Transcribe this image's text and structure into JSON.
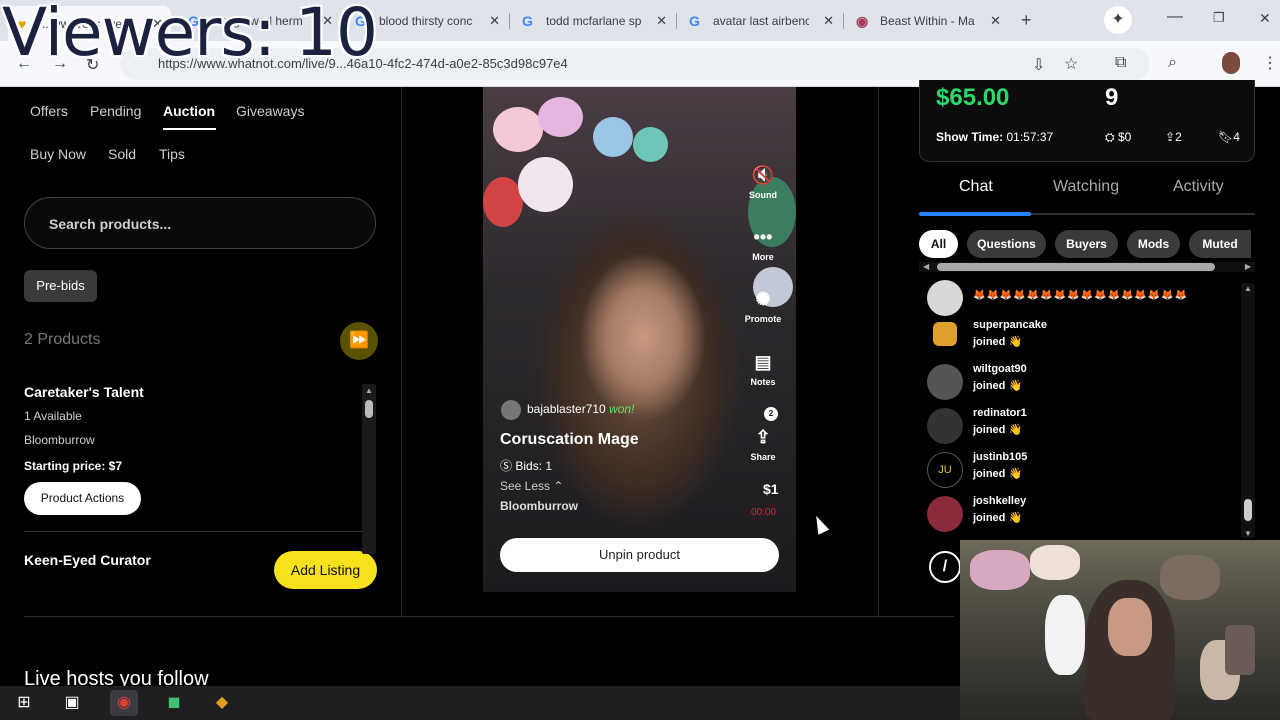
{
  "overlay": {
    "viewers": "Viewers: 10"
  },
  "browser": {
    "tabs": [
      {
        "title": "...lywave is live",
        "active": true
      },
      {
        "title": "is nightworl herm",
        "active": false
      },
      {
        "title": "blood thirsty conc",
        "active": false
      },
      {
        "title": "todd mcfarlane sp",
        "active": false
      },
      {
        "title": "avatar last airbenc",
        "active": false
      },
      {
        "title": "Beast Within - Ma",
        "active": false
      }
    ],
    "url": "https://www.whatnot.com/live/9...46a10-4fc2-474d-a0e2-85c3d98c97e4"
  },
  "left": {
    "tabs_row1": [
      "Offers",
      "Pending",
      "Auction",
      "Giveaways"
    ],
    "tabs_row2": [
      "Buy Now",
      "Sold",
      "Tips"
    ],
    "active_tab": "Auction",
    "search_placeholder": "Search products...",
    "prebids_label": "Pre-bids",
    "product_count": "2 Products",
    "products": [
      {
        "name": "Caretaker's Talent",
        "available": "1 Available",
        "set": "Bloomburrow",
        "starting_price": "Starting price: $7",
        "actions_label": "Product Actions"
      },
      {
        "name": "Keen-Eyed Curator"
      }
    ],
    "add_listing_label": "Add Listing",
    "live_hosts_heading": "Live hosts you follow"
  },
  "video": {
    "side_actions": [
      {
        "label": "Sound",
        "icon": "sound-off-icon"
      },
      {
        "label": "More",
        "icon": "more-icon"
      },
      {
        "label": "Promote",
        "icon": "promote-icon"
      },
      {
        "label": "Notes",
        "icon": "notes-icon"
      },
      {
        "label": "Share",
        "icon": "share-icon"
      }
    ],
    "share_badge": "2",
    "winner_user": "bajablaster710",
    "winner_status": "won!",
    "title": "Coruscation Mage",
    "bids": "Bids: 1",
    "see_less": "See Less",
    "set": "Bloomburrow",
    "price": "$1",
    "timer": "00:00",
    "unpin_label": "Unpin product"
  },
  "right": {
    "total_sales": "$65.00",
    "count": "9",
    "show_time_label": "Show Time:",
    "show_time": "01:57:37",
    "tips": "$0",
    "shares": "2",
    "bookmarks": "4",
    "tabs": [
      "Chat",
      "Watching",
      "Activity"
    ],
    "active_tab": "Chat",
    "filters": [
      "All",
      "Questions",
      "Buyers",
      "Mods",
      "Muted"
    ],
    "active_filter": "All",
    "messages": [
      {
        "user": "",
        "text": "🦊🦊🦊🦊🦊🦊🦊🦊🦊🦊🦊🦊🦊🦊🦊🦊"
      },
      {
        "user": "superpancake",
        "text": "joined 👋"
      },
      {
        "user": "wiltgoat90",
        "text": "joined 👋"
      },
      {
        "user": "redinator1",
        "text": "joined 👋"
      },
      {
        "user": "justinb105",
        "text": "joined 👋",
        "initials": "JU"
      },
      {
        "user": "joshkelley",
        "text": "joined 👋"
      }
    ],
    "command_icon": "/"
  },
  "colors": {
    "accent_green": "#2bd96b",
    "accent_yellow": "#f5e11c",
    "tab_blue": "#2684ff",
    "timer_red": "#e0203a"
  }
}
